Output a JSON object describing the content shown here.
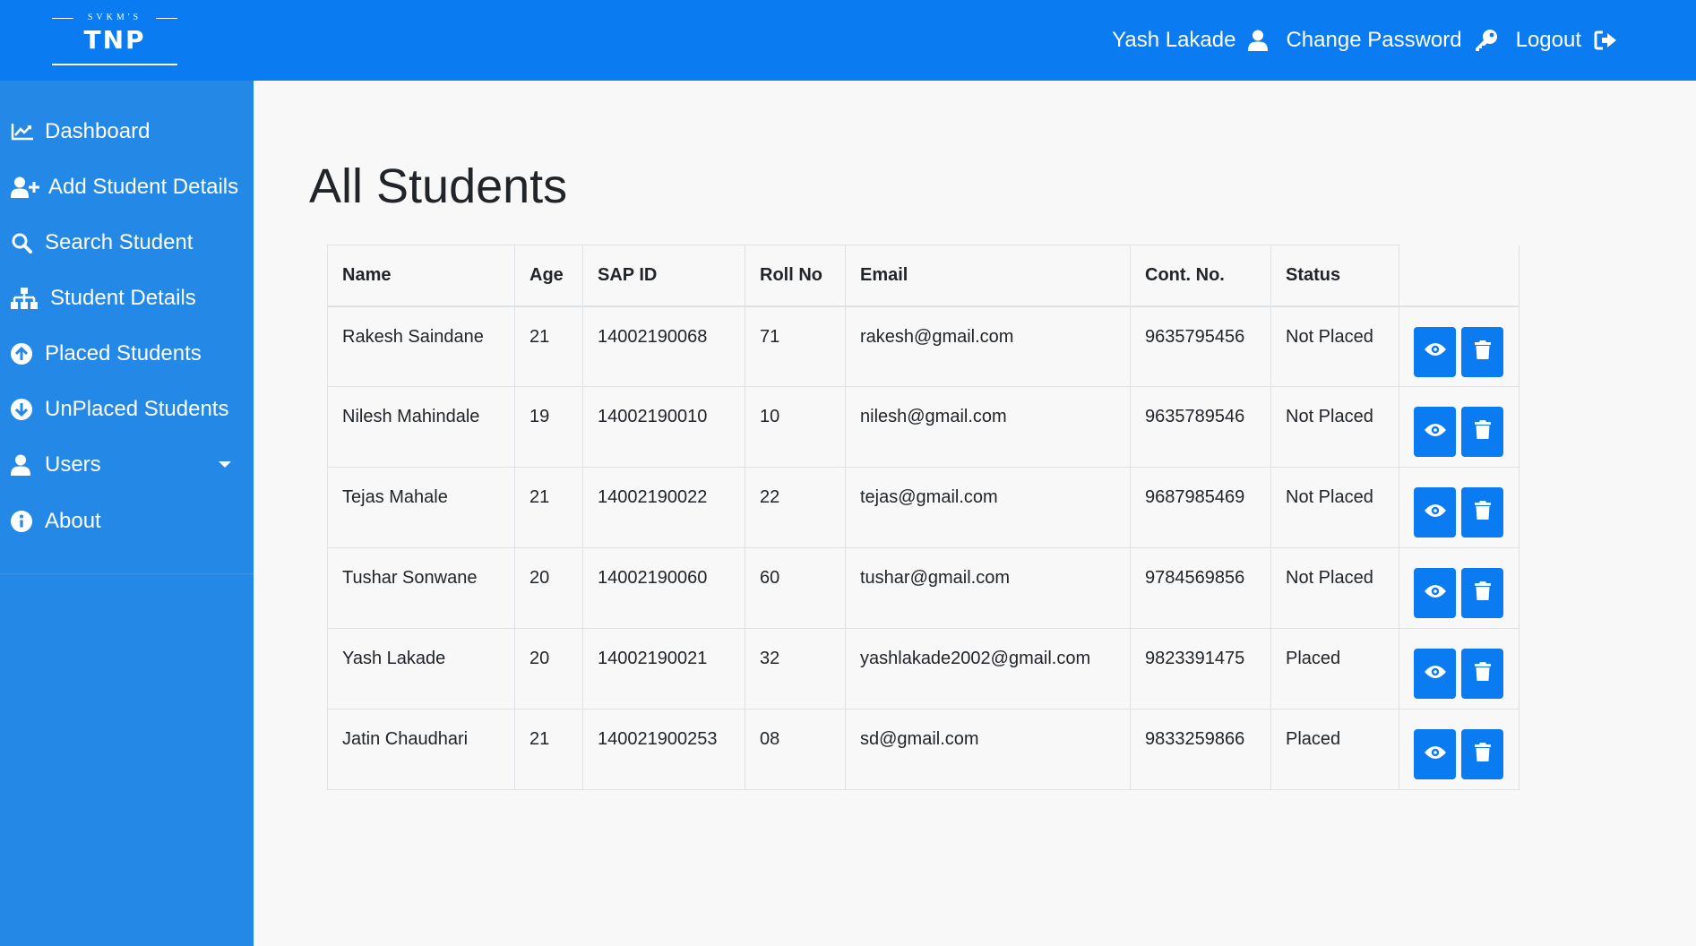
{
  "brand": {
    "top": "SVKM'S",
    "name": "TNP"
  },
  "topnav": {
    "user": "Yash Lakade",
    "change_password": "Change Password",
    "logout": "Logout"
  },
  "sidebar": {
    "items": [
      {
        "label": "Dashboard",
        "icon": "chart-line-icon"
      },
      {
        "label": "Add Student Details",
        "icon": "user-plus-icon"
      },
      {
        "label": "Search Student",
        "icon": "search-icon"
      },
      {
        "label": "Student Details",
        "icon": "sitemap-icon"
      },
      {
        "label": "Placed Students",
        "icon": "arrow-circle-up-icon"
      },
      {
        "label": "UnPlaced Students",
        "icon": "arrow-circle-down-icon"
      },
      {
        "label": "Users",
        "icon": "user-icon"
      },
      {
        "label": "About",
        "icon": "info-circle-icon"
      }
    ]
  },
  "page": {
    "title": "All Students"
  },
  "table": {
    "headers": [
      "Name",
      "Age",
      "SAP ID",
      "Roll No",
      "Email",
      "Cont. No.",
      "Status"
    ],
    "rows": [
      {
        "name": "Rakesh Saindane",
        "age": "21",
        "sap": "14002190068",
        "roll": "71",
        "email": "rakesh@gmail.com",
        "contact": "9635795456",
        "status": "Not Placed"
      },
      {
        "name": "Nilesh Mahindale",
        "age": "19",
        "sap": "14002190010",
        "roll": "10",
        "email": "nilesh@gmail.com",
        "contact": "9635789546",
        "status": "Not Placed"
      },
      {
        "name": "Tejas Mahale",
        "age": "21",
        "sap": "14002190022",
        "roll": "22",
        "email": "tejas@gmail.com",
        "contact": "9687985469",
        "status": "Not Placed"
      },
      {
        "name": "Tushar Sonwane",
        "age": "20",
        "sap": "14002190060",
        "roll": "60",
        "email": "tushar@gmail.com",
        "contact": "9784569856",
        "status": "Not Placed"
      },
      {
        "name": "Yash Lakade",
        "age": "20",
        "sap": "14002190021",
        "roll": "32",
        "email": "yashlakade2002@gmail.com",
        "contact": "9823391475",
        "status": "Placed"
      },
      {
        "name": "Jatin Chaudhari",
        "age": "21",
        "sap": "140021900253",
        "roll": "08",
        "email": "sd@gmail.com",
        "contact": "9833259866",
        "status": "Placed"
      }
    ]
  },
  "colors": {
    "primary": "#0a7bf0",
    "sidebar": "#2388e6",
    "not_placed": "#dc3545",
    "placed": "#28a745"
  }
}
